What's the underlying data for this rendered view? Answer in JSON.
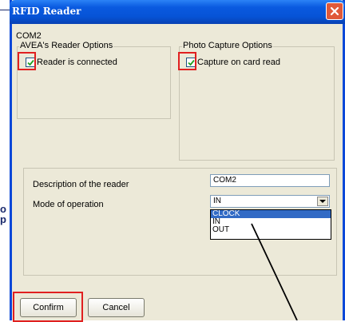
{
  "background_fragments": [
    "o",
    "p"
  ],
  "window": {
    "title": "RFID Reader",
    "section_title": "COM2",
    "reader_options": {
      "legend": "AVEA's Reader Options",
      "checkbox_label": "Reader is connected",
      "checked": true
    },
    "photo_options": {
      "legend": "Photo Capture Options",
      "checkbox_label": "Capture on card read",
      "checked": true
    },
    "description": {
      "label": "Description of the reader",
      "value": "COM2"
    },
    "mode": {
      "label": "Mode of operation",
      "selected": "IN",
      "options": [
        "CLOCK",
        "IN",
        "OUT"
      ],
      "highlighted": "CLOCK"
    },
    "buttons": {
      "confirm": "Confirm",
      "cancel": "Cancel"
    }
  },
  "colors": {
    "title_bar": "#0a5ae0",
    "highlight_box": "#e02020",
    "selection": "#316ac5"
  }
}
